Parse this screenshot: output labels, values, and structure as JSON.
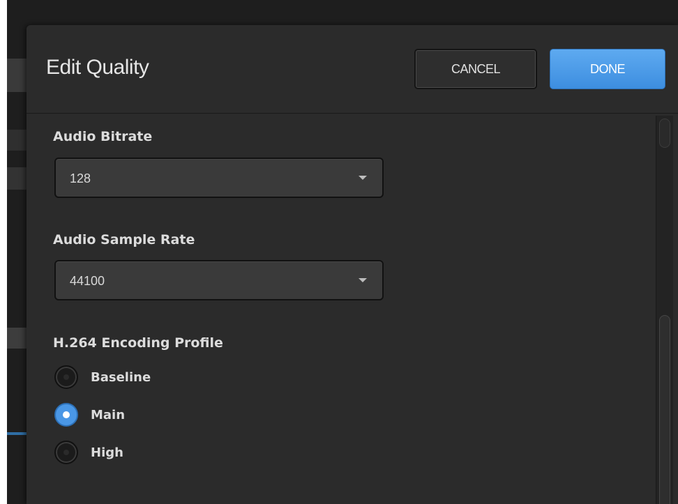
{
  "dialog": {
    "title": "Edit Quality",
    "cancel_label": "CANCEL",
    "done_label": "DONE"
  },
  "fields": {
    "audio_bitrate": {
      "label": "Audio Bitrate",
      "value": "128"
    },
    "audio_sample_rate": {
      "label": "Audio Sample Rate",
      "value": "44100"
    }
  },
  "encoding_profile": {
    "label": "H.264 Encoding Profile",
    "options": [
      {
        "label": "Baseline",
        "selected": false
      },
      {
        "label": "Main",
        "selected": true
      },
      {
        "label": "High",
        "selected": false
      }
    ]
  },
  "icons": {
    "select_arrow": "chevron-down-icon",
    "radio_dot": "radio-dot-icon"
  },
  "colors": {
    "accent": "#4a97e6",
    "dialog_bg": "#2b2b2b",
    "text": "#dcdcdc"
  }
}
